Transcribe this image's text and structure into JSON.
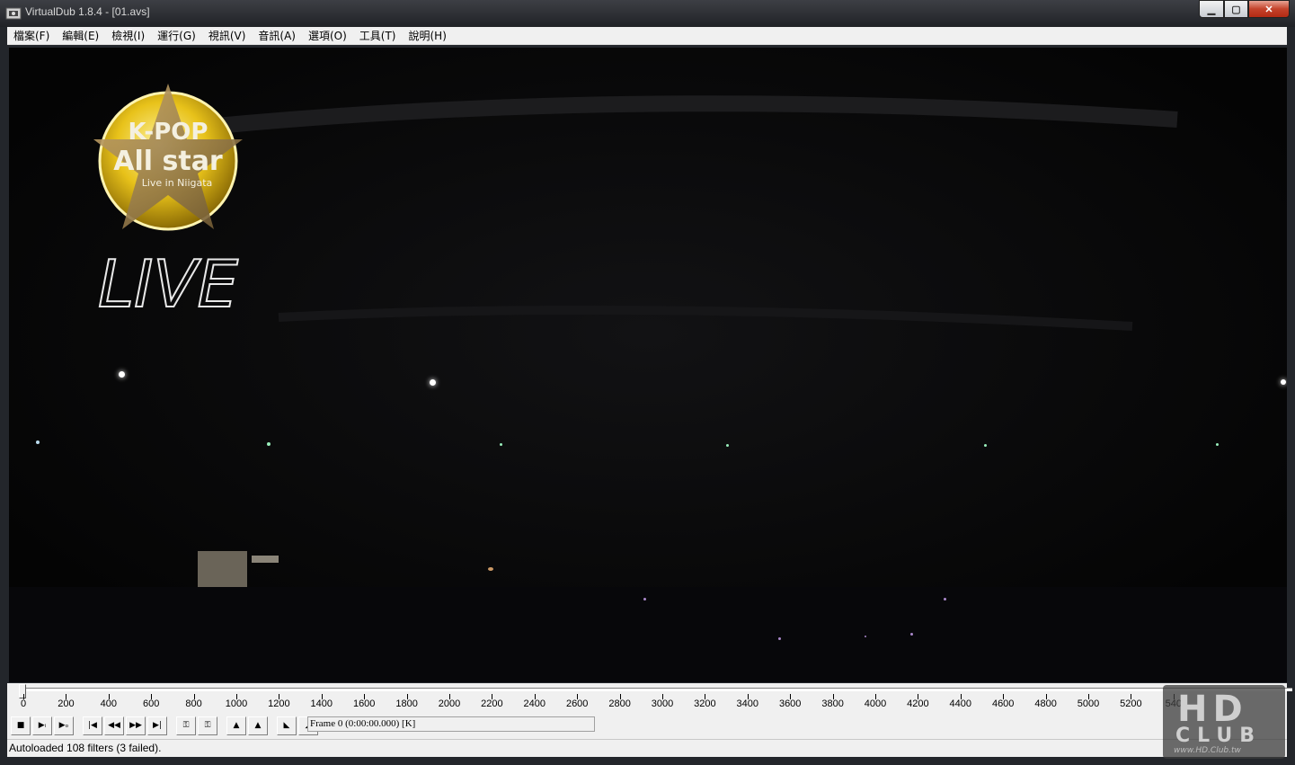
{
  "window": {
    "title": "VirtualDub 1.8.4 - [01.avs]"
  },
  "menu": [
    "檔案(F)",
    "編輯(E)",
    "檢視(I)",
    "運行(G)",
    "視訊(V)",
    "音訊(A)",
    "選項(O)",
    "工具(T)",
    "說明(H)"
  ],
  "video_overlay": {
    "logo_line1": "K-POP",
    "logo_line2": "All star",
    "logo_line3": "Live in Niigata",
    "live_text": "LIVE"
  },
  "timeline": {
    "position_frame": 0,
    "labels": [
      "0",
      "200",
      "400",
      "600",
      "800",
      "1000",
      "1200",
      "1400",
      "1600",
      "1800",
      "2000",
      "2200",
      "2400",
      "2600",
      "2800",
      "3000",
      "3200",
      "3400",
      "3600",
      "3800",
      "4000",
      "4200",
      "4400",
      "4600",
      "4800",
      "5000",
      "5200",
      "540"
    ]
  },
  "toolbar": {
    "buttons": [
      {
        "name": "stop-button",
        "glyph": "■"
      },
      {
        "name": "play-input-button",
        "glyph": "▶ᵢ"
      },
      {
        "name": "play-output-button",
        "glyph": "▶ₒ"
      },
      {
        "name": "go-start-button",
        "glyph": "|◀"
      },
      {
        "name": "prev-frame-button",
        "glyph": "◀◀"
      },
      {
        "name": "next-frame-button",
        "glyph": "▶▶"
      },
      {
        "name": "go-end-button",
        "glyph": "▶|"
      },
      {
        "name": "prev-keyframe-button",
        "glyph": "⚿"
      },
      {
        "name": "next-keyframe-button",
        "glyph": "⚿"
      },
      {
        "name": "prev-scene-button",
        "glyph": "▲"
      },
      {
        "name": "next-scene-button",
        "glyph": "▲"
      },
      {
        "name": "mark-in-button",
        "glyph": "◣"
      },
      {
        "name": "mark-out-button",
        "glyph": "◢"
      }
    ],
    "frame_display": "Frame 0 (0:00:00.000) [K]"
  },
  "status": {
    "text": "Autoloaded 108 filters (3 failed)."
  },
  "watermark": {
    "logo": "HD",
    "club": "CLUB",
    "url": "www.HD.Club.tw"
  }
}
